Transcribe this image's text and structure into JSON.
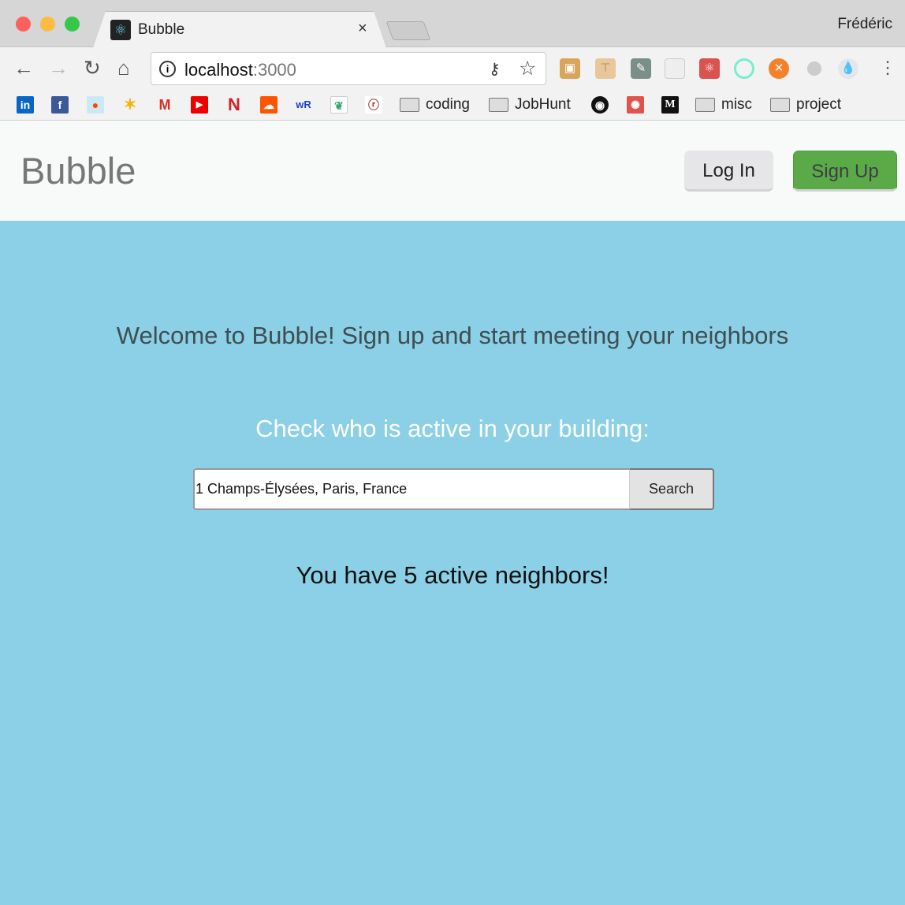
{
  "browser": {
    "tab_title": "Bubble",
    "tab_close": "×",
    "user": "Frédéric",
    "url_host": "localhost",
    "url_port": ":3000",
    "bookmarks": [
      {
        "icon": "linkedin-icon",
        "glyph": "in",
        "color": "#0a66c2"
      },
      {
        "icon": "facebook-icon",
        "glyph": "f",
        "color": "#3b5998"
      },
      {
        "icon": "reddit-icon",
        "glyph": "●",
        "color": "#cde8f5"
      },
      {
        "icon": "google-photos-icon",
        "glyph": "✶",
        "color": "#f4b400"
      },
      {
        "icon": "gmail-icon",
        "glyph": "M",
        "color": "#d93025"
      },
      {
        "icon": "youtube-icon",
        "glyph": "▶",
        "color": "#e00"
      },
      {
        "icon": "netflix-icon",
        "glyph": "N",
        "color": "#d81f26"
      },
      {
        "icon": "soundcloud-icon",
        "glyph": "☁",
        "color": "#f50"
      },
      {
        "icon": "wordreference-icon",
        "glyph": "wR",
        "color": "#ffffff"
      },
      {
        "icon": "plant-icon",
        "glyph": "❦",
        "color": "#ffffff"
      },
      {
        "icon": "ris-icon",
        "glyph": "ⓡ",
        "color": "#ffffff"
      }
    ],
    "folders": {
      "coding": "coding",
      "jobhunt": "JobHunt",
      "misc": "misc",
      "project": "project"
    }
  },
  "page": {
    "brand": "Bubble",
    "login_label": "Log In",
    "signup_label": "Sign Up",
    "welcome": "Welcome to Bubble! Sign up and start meeting your neighbors",
    "check_label": "Check who is active in your building:",
    "search_value": "1 Champs-Élysées, Paris, France",
    "search_button": "Search",
    "result": "You have 5 active neighbors!"
  }
}
